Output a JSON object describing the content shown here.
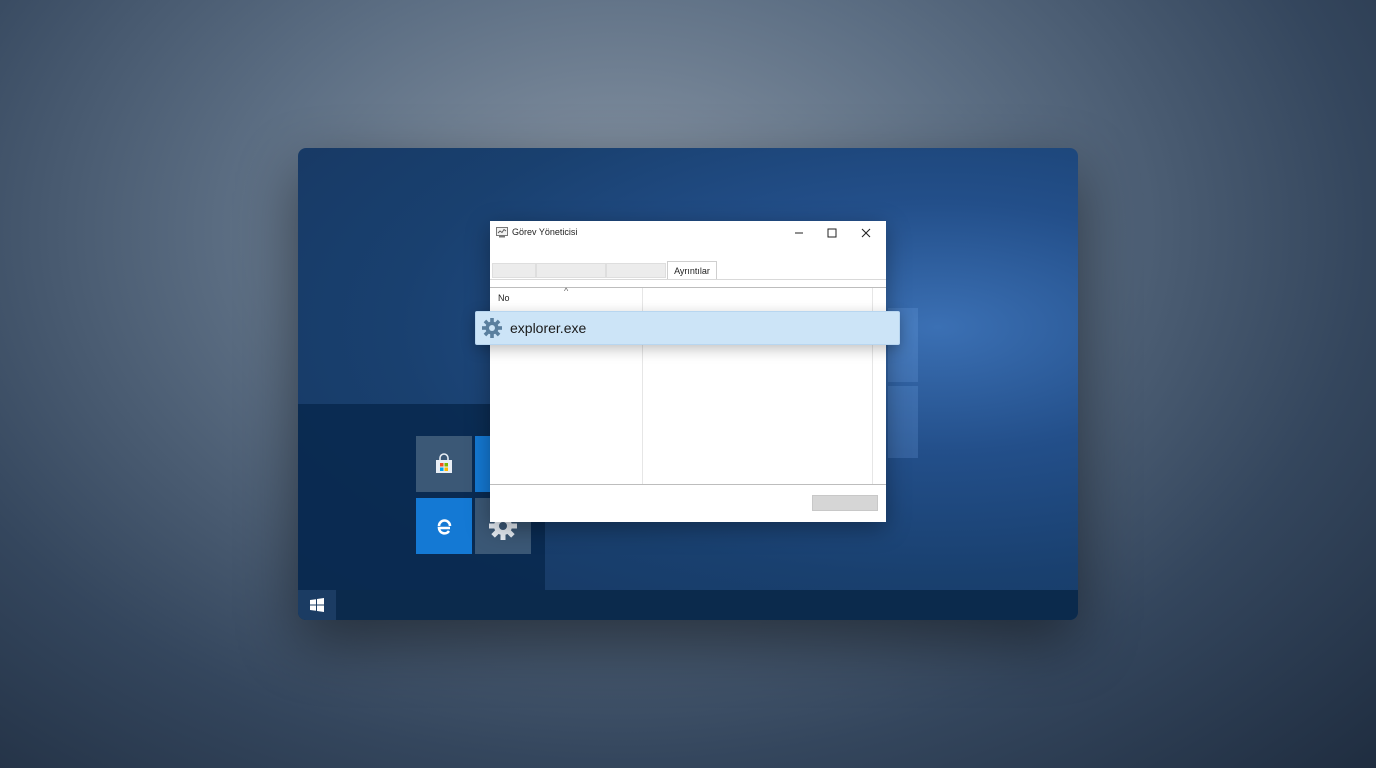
{
  "task_manager": {
    "title": "Görev Yöneticisi",
    "icon": "task-manager-icon",
    "tabs": [
      {
        "label": ""
      },
      {
        "label": ""
      },
      {
        "label": ""
      },
      {
        "label": "Ayrıntılar",
        "active": true
      }
    ],
    "column_header": "No",
    "end_task_label": "",
    "controls": [
      "minimize-icon",
      "maximize-icon",
      "close-icon"
    ]
  },
  "highlighted_process": {
    "name": "explorer.exe",
    "icon": "gear-icon"
  },
  "start_menu": {
    "tiles": [
      {
        "icon": "store-icon",
        "color": "#3b5876"
      },
      {
        "icon": "mail-icon",
        "color": "#1479d4"
      },
      {
        "icon": "edge-icon",
        "color": "#1479d4"
      },
      {
        "icon": "settings-icon",
        "color": "#3b5876"
      }
    ]
  },
  "taskbar": {
    "start_icon": "windows-logo-icon"
  },
  "colors": {
    "selection": "#cce4f7",
    "accent": "#1479d4",
    "taskbar": "#0b2a4c"
  }
}
